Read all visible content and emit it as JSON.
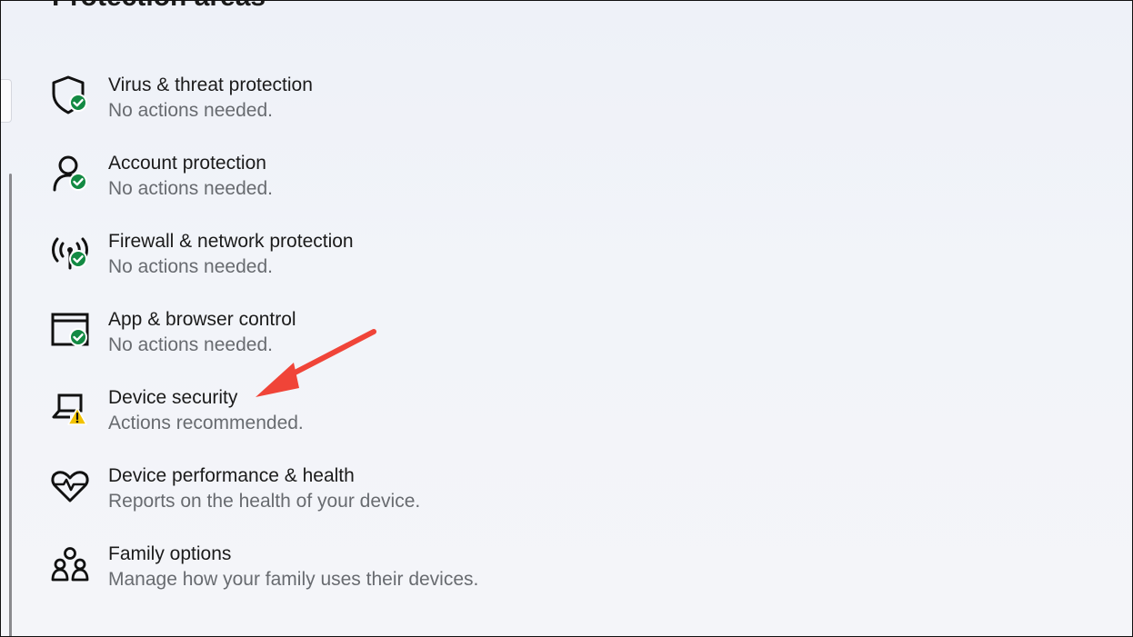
{
  "page": {
    "section_heading": "Protection areas"
  },
  "areas": [
    {
      "title": "Virus & threat protection",
      "status": "No actions needed.",
      "icon": "shield-icon",
      "badge": "ok"
    },
    {
      "title": "Account protection",
      "status": "No actions needed.",
      "icon": "account-icon",
      "badge": "ok"
    },
    {
      "title": "Firewall & network protection",
      "status": "No actions needed.",
      "icon": "firewall-antenna-icon",
      "badge": "ok"
    },
    {
      "title": "App & browser control",
      "status": "No actions needed.",
      "icon": "app-browser-window-icon",
      "badge": "ok"
    },
    {
      "title": "Device security",
      "status": "Actions recommended.",
      "icon": "laptop-icon",
      "badge": "warning"
    },
    {
      "title": "Device performance & health",
      "status": "Reports on the health of your device.",
      "icon": "heart-pulse-icon",
      "badge": "none"
    },
    {
      "title": "Family options",
      "status": "Manage how your family uses their devices.",
      "icon": "family-icon",
      "badge": "none"
    }
  ],
  "colors": {
    "ok_badge": "#138a43",
    "warning_badge": "#f2c200",
    "annotation_arrow": "#f04438"
  }
}
